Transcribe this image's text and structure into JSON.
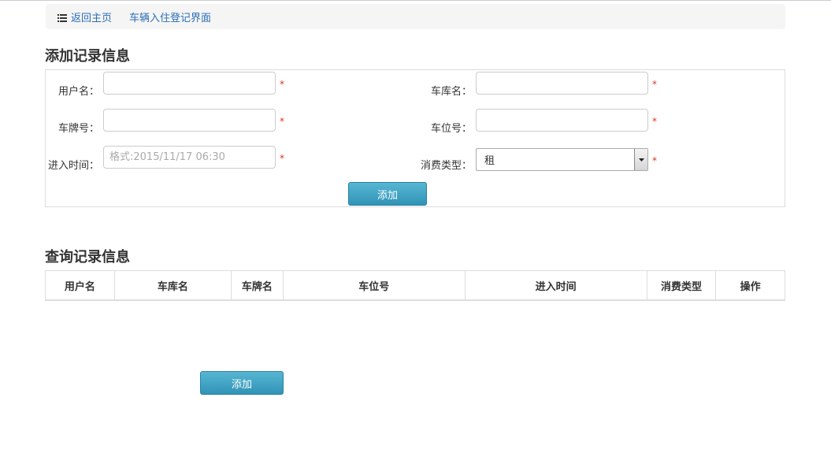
{
  "breadcrumb": {
    "home": "返回主页",
    "current": "车辆入住登记界面"
  },
  "add_section": {
    "title": "添加记录信息",
    "fields": {
      "username": {
        "label": "用户名：",
        "value": "",
        "placeholder": ""
      },
      "garage_name": {
        "label": "车库名：",
        "value": "",
        "placeholder": ""
      },
      "plate_number": {
        "label": "车牌号：",
        "value": "",
        "placeholder": ""
      },
      "space_number": {
        "label": "车位号：",
        "value": "",
        "placeholder": ""
      },
      "entry_time": {
        "label": "进入时间：",
        "value": "",
        "placeholder": "格式:2015/11/17 06:30"
      },
      "consumption_type": {
        "label": "消费类型：",
        "selected": "租"
      }
    },
    "required_mark": "*",
    "add_button": "添加"
  },
  "query_section": {
    "title": "查询记录信息",
    "columns": [
      "用户名",
      "车库名",
      "车牌名",
      "车位号",
      "进入时间",
      "消费类型",
      "操作"
    ],
    "rows": [],
    "add_button": "添加"
  },
  "colors": {
    "accent": "#2a6fb5",
    "button": "#3ea3c5",
    "required": "#d9361c"
  }
}
